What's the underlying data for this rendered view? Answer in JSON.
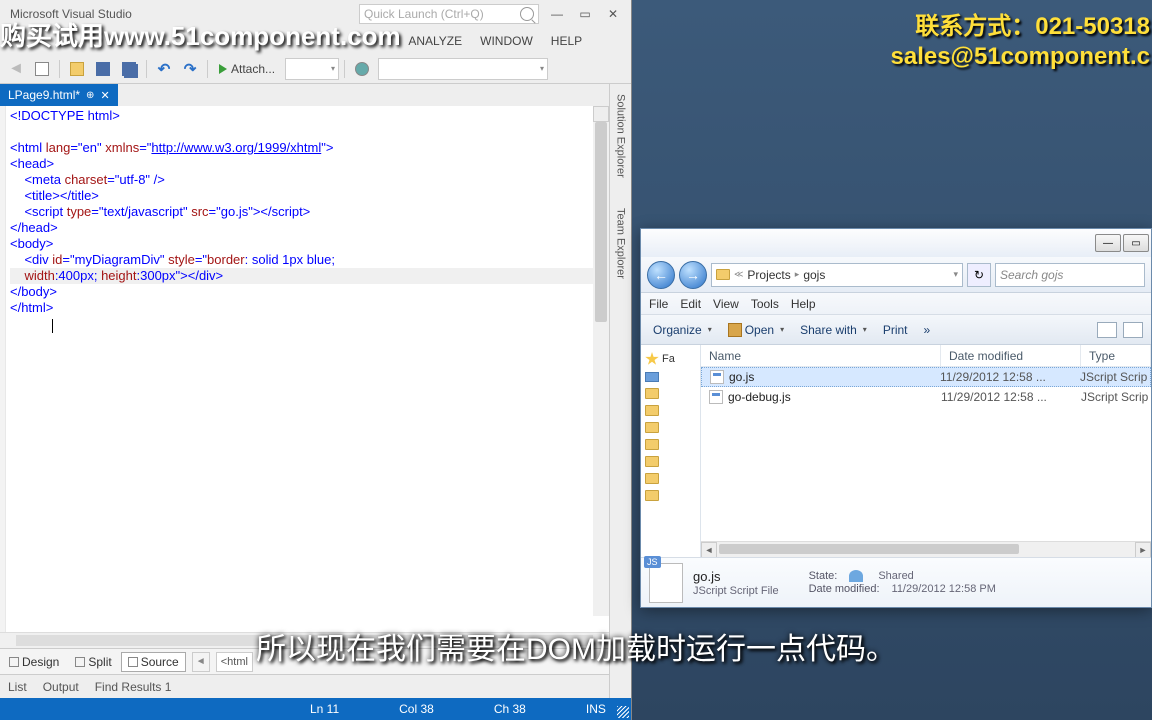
{
  "overlays": {
    "top_left": "购买试用www.51component.com",
    "top_right_line1": "联系方式：021-50318",
    "top_right_line2": "sales@51component.c",
    "subtitle": "所以现在我们需要在DOM加载时运行一点代码。"
  },
  "vs": {
    "title_suffix": "Microsoft Visual Studio",
    "quick_launch_placeholder": "Quick Launch (Ctrl+Q)",
    "menu": {
      "analyze": "ANALYZE",
      "window": "WINDOW",
      "help": "HELP"
    },
    "toolbar": {
      "attach": "Attach..."
    },
    "tab": {
      "name": "LPage9.html*"
    },
    "side_tabs": {
      "solution": "Solution Explorer",
      "team": "Team Explorer"
    },
    "view_modes": {
      "design": "Design",
      "split": "Split",
      "source": "Source"
    },
    "breadcrumb": "<html",
    "bottom_tabs": {
      "list": "List",
      "output": "Output",
      "find": "Find Results 1"
    },
    "status": {
      "ln": "Ln 11",
      "col": "Col 38",
      "ch": "Ch 38",
      "ins": "INS"
    },
    "code": {
      "l1": "<!DOCTYPE html>",
      "l3a": "<html ",
      "l3b": "lang",
      "l3c": "=\"en\" ",
      "l3d": "xmlns",
      "l3e": "=\"",
      "l3link": "http://www.w3.org/1999/xhtml",
      "l3f": "\">",
      "l4": "<head>",
      "l5a": "    <meta ",
      "l5b": "charset",
      "l5c": "=\"utf-8\" />",
      "l6": "    <title></title>",
      "l7a": "    <script ",
      "l7b": "type",
      "l7c": "=\"text/javascript\" ",
      "l7d": "src",
      "l7e": "=\"go.js\"></",
      "l7f": "script>",
      "l8": "</head>",
      "l9": "<body>",
      "l10a": "    <div ",
      "l10b": "id",
      "l10c": "=\"myDiagramDiv\" ",
      "l10d": "style",
      "l10e": "=\"",
      "l10f": "border",
      "l10g": ": solid 1px blue;",
      "l11a": "    ",
      "l11b": "width",
      "l11c": ":400px; ",
      "l11d": "height",
      "l11e": ":300px\"></div>",
      "l12": "</body>",
      "l13": "</html>"
    }
  },
  "explorer": {
    "address": {
      "seg1": "Projects",
      "seg2": "gojs"
    },
    "search_placeholder": "Search gojs",
    "menu": {
      "file": "File",
      "edit": "Edit",
      "view": "View",
      "tools": "Tools",
      "help": "Help"
    },
    "toolbar": {
      "organize": "Organize",
      "open": "Open",
      "share": "Share with",
      "print": "Print"
    },
    "tree": {
      "fav": "Fa"
    },
    "columns": {
      "name": "Name",
      "date": "Date modified",
      "type": "Type"
    },
    "files": [
      {
        "name": "go.js",
        "date": "11/29/2012 12:58 ...",
        "type": "JScript Scrip"
      },
      {
        "name": "go-debug.js",
        "date": "11/29/2012 12:58 ...",
        "type": "JScript Scrip"
      }
    ],
    "details": {
      "name": "go.js",
      "filetype": "JScript Script File",
      "state_label": "State:",
      "state_value": "Shared",
      "date_label": "Date modified:",
      "date_value": "11/29/2012 12:58 PM"
    }
  }
}
